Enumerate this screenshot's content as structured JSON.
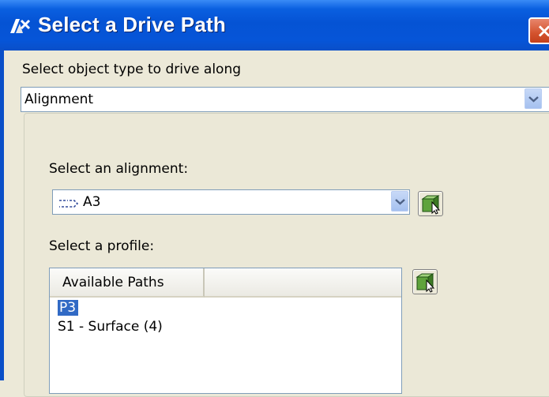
{
  "window": {
    "title": "Select a Drive Path",
    "close_glyph": "×"
  },
  "object_type": {
    "label": "Select object type to drive along",
    "value": "Alignment"
  },
  "alignment": {
    "label": "Select an alignment:",
    "value": "A3",
    "icon": "alignment-icon"
  },
  "profile": {
    "label": "Select a profile:",
    "column_header": "Available Paths",
    "items": [
      {
        "label": "P3",
        "selected": true
      },
      {
        "label": "S1 - Surface (4)",
        "selected": false
      }
    ]
  },
  "colors": {
    "titlebar": "#0553d4",
    "selection": "#316ac5",
    "window_bg": "#ece9d8"
  }
}
